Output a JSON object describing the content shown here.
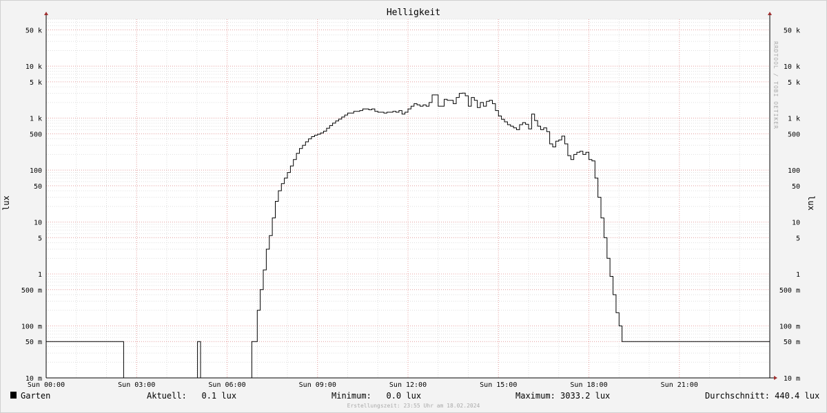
{
  "chart_data": {
    "type": "line",
    "title": "Helligkeit",
    "ylabel": "lux",
    "watermark": "RRDTOOL / TOBI OETIKER",
    "yscale": "log",
    "ylim": [
      0.01,
      80000
    ],
    "xlim": [
      0,
      24
    ],
    "y_ticks": [
      {
        "v": 0.01,
        "label": "10 m"
      },
      {
        "v": 0.05,
        "label": "50 m"
      },
      {
        "v": 0.1,
        "label": "100 m"
      },
      {
        "v": 0.5,
        "label": "500 m"
      },
      {
        "v": 1,
        "label": "1"
      },
      {
        "v": 5,
        "label": "5"
      },
      {
        "v": 10,
        "label": "10"
      },
      {
        "v": 50,
        "label": "50"
      },
      {
        "v": 100,
        "label": "100"
      },
      {
        "v": 500,
        "label": "500"
      },
      {
        "v": 1000,
        "label": "1 k"
      },
      {
        "v": 5000,
        "label": "5 k"
      },
      {
        "v": 10000,
        "label": "10 k"
      },
      {
        "v": 50000,
        "label": "50 k"
      }
    ],
    "x_ticks": [
      {
        "v": 0,
        "label": "Sun 00:00"
      },
      {
        "v": 3,
        "label": "Sun 03:00"
      },
      {
        "v": 6,
        "label": "Sun 06:00"
      },
      {
        "v": 9,
        "label": "Sun 09:00"
      },
      {
        "v": 12,
        "label": "Sun 12:00"
      },
      {
        "v": 15,
        "label": "Sun 15:00"
      },
      {
        "v": 18,
        "label": "Sun 18:00"
      },
      {
        "v": 21,
        "label": "Sun 21:00"
      }
    ],
    "grid": true,
    "series": [
      {
        "name": "Garten",
        "color": "#000000",
        "points": [
          [
            0.0,
            0.05
          ],
          [
            2.55,
            0.05
          ],
          [
            2.57,
            0.01
          ],
          [
            5.0,
            0.01
          ],
          [
            5.02,
            0.05
          ],
          [
            5.1,
            0.05
          ],
          [
            5.12,
            0.01
          ],
          [
            6.8,
            0.01
          ],
          [
            6.82,
            0.05
          ],
          [
            6.95,
            0.05
          ],
          [
            7.0,
            0.2
          ],
          [
            7.1,
            0.5
          ],
          [
            7.2,
            1.2
          ],
          [
            7.3,
            3
          ],
          [
            7.4,
            5.5
          ],
          [
            7.5,
            12
          ],
          [
            7.6,
            25
          ],
          [
            7.7,
            40
          ],
          [
            7.8,
            55
          ],
          [
            7.9,
            70
          ],
          [
            8.0,
            90
          ],
          [
            8.1,
            120
          ],
          [
            8.2,
            160
          ],
          [
            8.3,
            210
          ],
          [
            8.4,
            260
          ],
          [
            8.5,
            300
          ],
          [
            8.6,
            350
          ],
          [
            8.7,
            400
          ],
          [
            8.8,
            440
          ],
          [
            8.9,
            470
          ],
          [
            9.0,
            490
          ],
          [
            9.1,
            520
          ],
          [
            9.2,
            560
          ],
          [
            9.3,
            640
          ],
          [
            9.4,
            720
          ],
          [
            9.5,
            800
          ],
          [
            9.6,
            880
          ],
          [
            9.7,
            960
          ],
          [
            9.8,
            1050
          ],
          [
            9.9,
            1150
          ],
          [
            10.0,
            1250
          ],
          [
            10.2,
            1350
          ],
          [
            10.4,
            1400
          ],
          [
            10.5,
            1500
          ],
          [
            10.7,
            1450
          ],
          [
            10.8,
            1500
          ],
          [
            10.9,
            1350
          ],
          [
            11.0,
            1300
          ],
          [
            11.2,
            1250
          ],
          [
            11.3,
            1300
          ],
          [
            11.5,
            1350
          ],
          [
            11.6,
            1300
          ],
          [
            11.7,
            1400
          ],
          [
            11.8,
            1200
          ],
          [
            11.9,
            1300
          ],
          [
            12.0,
            1500
          ],
          [
            12.1,
            1700
          ],
          [
            12.2,
            1900
          ],
          [
            12.3,
            1800
          ],
          [
            12.4,
            1700
          ],
          [
            12.5,
            1800
          ],
          [
            12.6,
            1700
          ],
          [
            12.7,
            2000
          ],
          [
            12.8,
            2800
          ],
          [
            12.9,
            2800
          ],
          [
            13.0,
            1700
          ],
          [
            13.1,
            1700
          ],
          [
            13.2,
            2300
          ],
          [
            13.3,
            2200
          ],
          [
            13.4,
            2200
          ],
          [
            13.5,
            1900
          ],
          [
            13.6,
            2500
          ],
          [
            13.7,
            3000
          ],
          [
            13.8,
            3033.2
          ],
          [
            13.9,
            2700
          ],
          [
            14.0,
            1700
          ],
          [
            14.1,
            2500
          ],
          [
            14.2,
            2200
          ],
          [
            14.3,
            1600
          ],
          [
            14.4,
            2000
          ],
          [
            14.5,
            1700
          ],
          [
            14.6,
            2100
          ],
          [
            14.7,
            2200
          ],
          [
            14.8,
            1900
          ],
          [
            14.9,
            1400
          ],
          [
            15.0,
            1100
          ],
          [
            15.1,
            950
          ],
          [
            15.2,
            850
          ],
          [
            15.3,
            750
          ],
          [
            15.4,
            700
          ],
          [
            15.5,
            650
          ],
          [
            15.6,
            600
          ],
          [
            15.7,
            750
          ],
          [
            15.8,
            820
          ],
          [
            15.9,
            760
          ],
          [
            16.0,
            620
          ],
          [
            16.1,
            1200
          ],
          [
            16.2,
            900
          ],
          [
            16.3,
            700
          ],
          [
            16.4,
            600
          ],
          [
            16.5,
            650
          ],
          [
            16.6,
            550
          ],
          [
            16.7,
            320
          ],
          [
            16.8,
            280
          ],
          [
            16.9,
            360
          ],
          [
            17.0,
            380
          ],
          [
            17.1,
            450
          ],
          [
            17.2,
            320
          ],
          [
            17.3,
            190
          ],
          [
            17.4,
            160
          ],
          [
            17.5,
            200
          ],
          [
            17.6,
            220
          ],
          [
            17.7,
            230
          ],
          [
            17.8,
            200
          ],
          [
            17.9,
            220
          ],
          [
            18.0,
            160
          ],
          [
            18.1,
            150
          ],
          [
            18.2,
            70
          ],
          [
            18.3,
            30
          ],
          [
            18.4,
            12
          ],
          [
            18.5,
            5
          ],
          [
            18.6,
            2
          ],
          [
            18.7,
            0.9
          ],
          [
            18.8,
            0.4
          ],
          [
            18.9,
            0.18
          ],
          [
            19.0,
            0.1
          ],
          [
            19.1,
            0.05
          ],
          [
            24.0,
            0.05
          ]
        ]
      }
    ],
    "legend": {
      "name": "Garten",
      "current": "Aktuell:   0.1 lux",
      "minimum": "Minimum:   0.0 lux",
      "maximum": "Maximum: 3033.2 lux",
      "average": "Durchschnitt: 440.4 lux"
    },
    "footer": "Erstellungszeit: 23:55 Uhr am 18.02.2024"
  }
}
